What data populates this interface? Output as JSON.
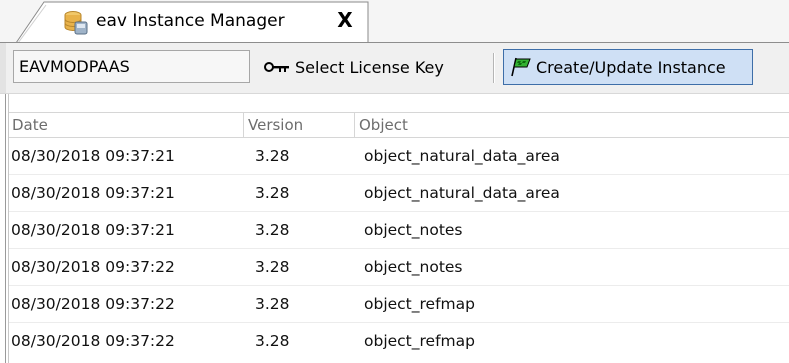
{
  "tab": {
    "title": "eav Instance Manager",
    "close_glyph": "X",
    "icon": "database-icon"
  },
  "toolbar": {
    "instance_value": "EAVMODPAAS",
    "license_label": "Select License Key",
    "license_icon": "key-icon",
    "create_label": "Create/Update Instance",
    "create_icon": "green-flag-icon"
  },
  "table": {
    "columns": [
      "Date",
      "Version",
      "Object"
    ],
    "rows": [
      {
        "date": "08/30/2018 09:37:21",
        "version": "3.28",
        "object": "object_natural_data_area"
      },
      {
        "date": "08/30/2018 09:37:21",
        "version": "3.28",
        "object": "object_natural_data_area"
      },
      {
        "date": "08/30/2018 09:37:21",
        "version": "3.28",
        "object": "object_notes"
      },
      {
        "date": "08/30/2018 09:37:22",
        "version": "3.28",
        "object": "object_notes"
      },
      {
        "date": "08/30/2018 09:37:22",
        "version": "3.28",
        "object": "object_refmap"
      },
      {
        "date": "08/30/2018 09:37:22",
        "version": "3.28",
        "object": "object_refmap"
      }
    ]
  },
  "colors": {
    "create_button_bg": "#cfe0f5",
    "create_button_border": "#3e6ea8",
    "flag_green": "#2a9a2a"
  }
}
